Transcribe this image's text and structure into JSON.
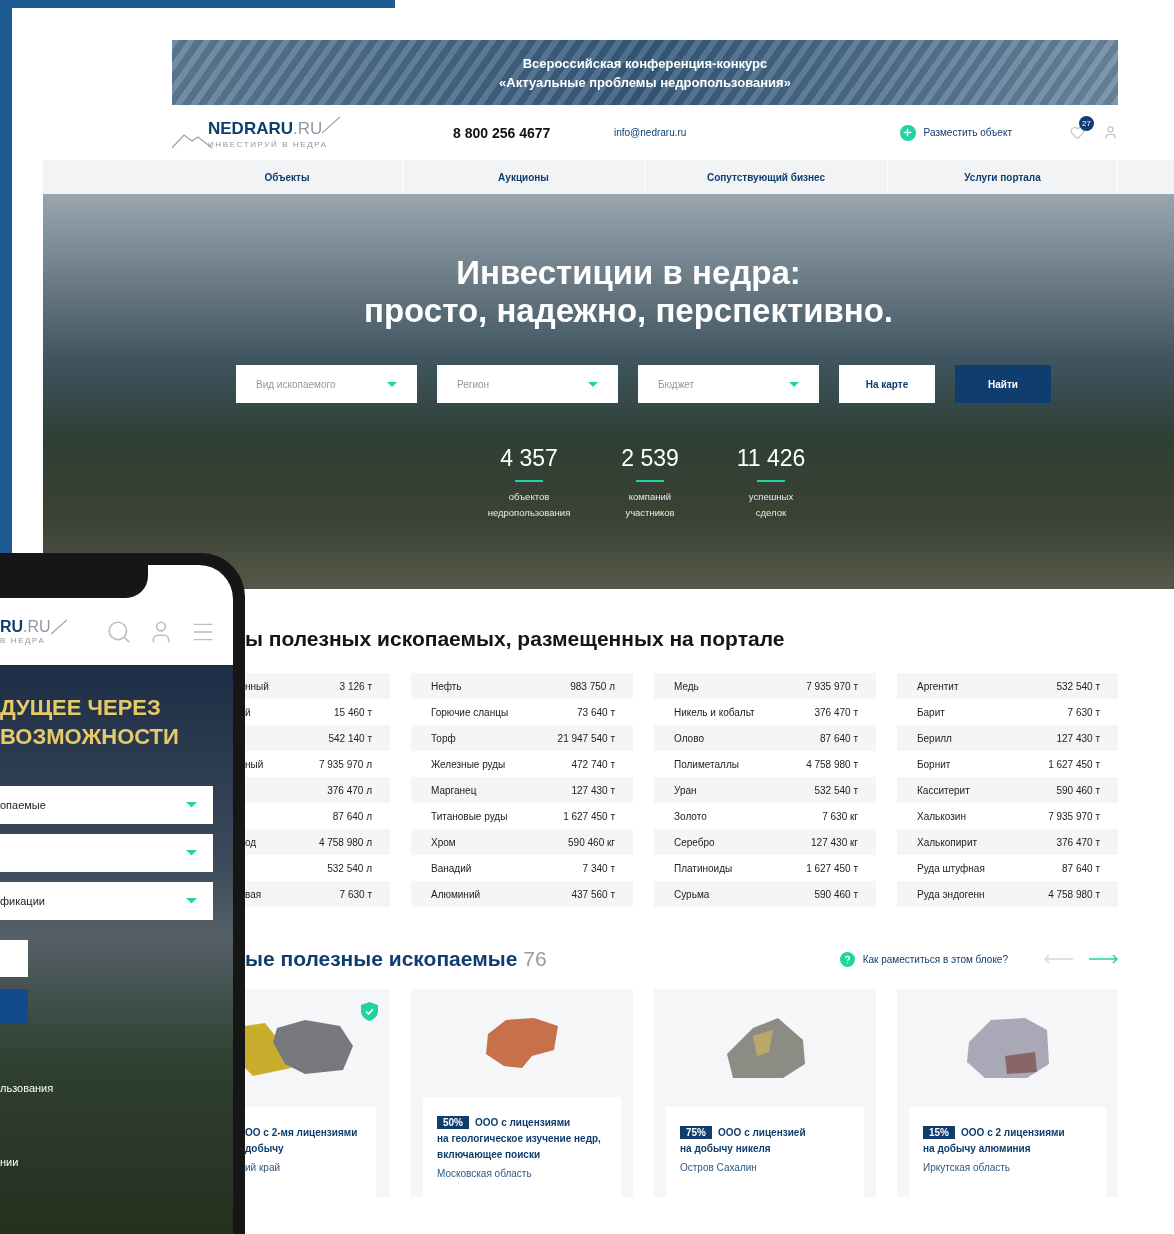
{
  "banner": {
    "lines": [
      "Всероссийская конференция-конкурс",
      "«Актуальные проблемы недропользования»"
    ]
  },
  "header": {
    "logo": {
      "name": "NEDRARU",
      "domain": ".RU",
      "tagline": "ИНВЕСТИРУЙ В НЕДРА"
    },
    "phone": "8 800 256 4677",
    "email": "info@nedraru.ru",
    "add_object": "Разместить объект",
    "favorites_count": "27"
  },
  "nav": [
    {
      "label": "Объекты"
    },
    {
      "label": "Аукционы"
    },
    {
      "label": "Сопутствующий бизнес"
    },
    {
      "label": "Услуги портала"
    }
  ],
  "hero": {
    "title_lines": [
      "Инвестиции в недра:",
      "просто, надежно, перспективно."
    ],
    "filters": [
      {
        "kind": "select",
        "placeholder": "Вид ископаемого"
      },
      {
        "kind": "select",
        "placeholder": "Регион"
      },
      {
        "kind": "select",
        "placeholder": "Бюджет"
      },
      {
        "kind": "button",
        "label": "На карте"
      },
      {
        "kind": "primary",
        "label": "Найти"
      }
    ],
    "stats": [
      {
        "value": "4 357",
        "label_lines": [
          "объектов",
          "недропользования"
        ]
      },
      {
        "value": "2 539",
        "label_lines": [
          "компаний",
          "участников"
        ]
      },
      {
        "value": "11 426",
        "label_lines": [
          "успешных",
          "сделок"
        ]
      }
    ]
  },
  "minerals": {
    "heading": "ы полезных ископаемых, размещенных на портале",
    "columns": [
      [
        {
          "name": "нный",
          "amount": "3 126 т"
        },
        {
          "name": "й",
          "amount": "15 460 т"
        },
        {
          "amount": "542 140 т"
        },
        {
          "name": "ный",
          "amount": "7 935 970 л"
        },
        {
          "amount": "376 470 л"
        },
        {
          "amount": "87 640 л"
        },
        {
          "name": "од",
          "amount": "4 758 980 л"
        },
        {
          "amount": "532 540 л"
        },
        {
          "name": "вая",
          "amount": "7 630 т"
        }
      ],
      [
        {
          "name": "Нефть",
          "amount": "983 750 л"
        },
        {
          "name": "Горючие сланцы",
          "amount": "73 640 т"
        },
        {
          "name": "Торф",
          "amount": "21 947 540 т"
        },
        {
          "name": "Железные руды",
          "amount": "472 740 т"
        },
        {
          "name": "Марганец",
          "amount": "127 430 т"
        },
        {
          "name": "Титановые руды",
          "amount": "1 627 450 т"
        },
        {
          "name": "Хром",
          "amount": "590 460 кг"
        },
        {
          "name": "Ванадий",
          "amount": "7 340 т"
        },
        {
          "name": "Алюминий",
          "amount": "437 560 т"
        }
      ],
      [
        {
          "name": "Медь",
          "amount": "7 935 970 т"
        },
        {
          "name": "Никель и кобальт",
          "amount": "376 470 т"
        },
        {
          "name": "Олово",
          "amount": "87 640 т"
        },
        {
          "name": "Полиметаллы",
          "amount": "4 758 980 т"
        },
        {
          "name": "Уран",
          "amount": "532 540 т"
        },
        {
          "name": "Золото",
          "amount": "7 630 кг"
        },
        {
          "name": "Серебро",
          "amount": "127 430 кг"
        },
        {
          "name": "Платиноиды",
          "amount": "1 627 450 т"
        },
        {
          "name": "Сурьма",
          "amount": "590 460 т"
        }
      ],
      [
        {
          "name": "Аргентит",
          "amount": "532 540 т"
        },
        {
          "name": "Барит",
          "amount": "7 630 т"
        },
        {
          "name": "Берилл",
          "amount": "127 430 т"
        },
        {
          "name": "Борнит",
          "amount": "1 627 450 т"
        },
        {
          "name": "Касситерит",
          "amount": "590 460 т"
        },
        {
          "name": "Халькозин",
          "amount": "7 935 970 т"
        },
        {
          "name": "Халькопирит",
          "amount": "376 470 т"
        },
        {
          "name": "Руда штуфная",
          "amount": "87 640 т"
        },
        {
          "name": "Руда эндогенн",
          "amount": "4 758 980 т"
        }
      ]
    ]
  },
  "featured": {
    "heading": "ые полезные ископаемые",
    "count": "76",
    "help_link": "Как раместиться в этом блоке?",
    "arrows": [
      {
        "kind": "prev",
        "disabled": true
      },
      {
        "kind": "next",
        "disabled": false
      }
    ],
    "cards": [
      {
        "verified": true,
        "title_lines": [
          "ОО с 2-мя лицензиями",
          "добычу"
        ],
        "region": "ий край"
      },
      {
        "verified": false,
        "share": "50%",
        "title_lines": [
          "ООО с лицензиями",
          "на геологическое изучение недр,",
          "включающее поиски"
        ],
        "region": "Московская область"
      },
      {
        "verified": false,
        "share": "75%",
        "title_lines": [
          "ООО с лицензией",
          "на добычу никеля"
        ],
        "region": "Остров Сахалин"
      },
      {
        "verified": false,
        "share": "15%",
        "title_lines": [
          "ООО с 2 лицензиями",
          "на добычу алюминия"
        ],
        "region": "Иркутская область"
      }
    ]
  },
  "phone": {
    "logo": {
      "name": "RU",
      "domain": ".RU",
      "tagline": "В НЕДРА"
    },
    "title_lines": [
      "ДУЩЕЕ ЧЕРЕЗ",
      "ВОЗМОЖНОСТИ"
    ],
    "controls": [
      {
        "kind": "select",
        "value": "опаемые"
      },
      {
        "kind": "select"
      },
      {
        "kind": "select",
        "value": "фикации"
      },
      {
        "kind": "input"
      },
      {
        "kind": "button"
      }
    ],
    "texts": [
      "льзования",
      "нии"
    ]
  }
}
